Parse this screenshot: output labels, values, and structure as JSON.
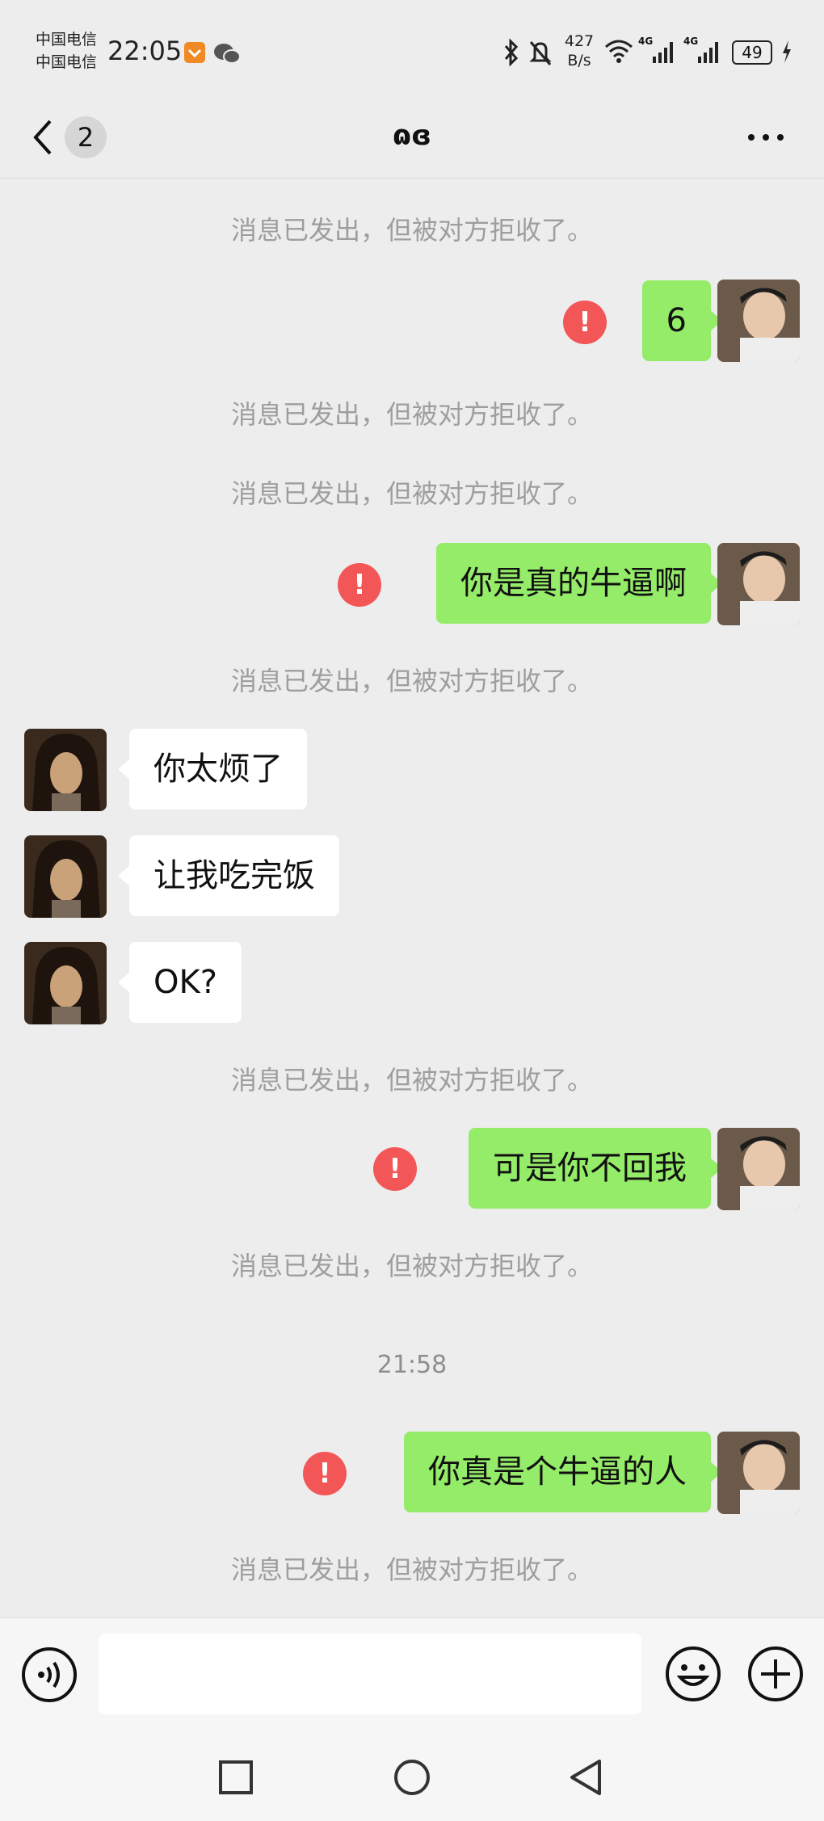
{
  "status_bar": {
    "carrier_1": "中国电信",
    "carrier_2": "中国电信",
    "time": "22:05",
    "net_speed_value": "427",
    "net_speed_unit": "B/s",
    "signal_1": "4G",
    "signal_2": "4G",
    "battery": "49"
  },
  "header": {
    "unread_count": "2",
    "title": "ɷɞ"
  },
  "messages": {
    "m01_sys": "消息已发出，但被对方拒收了。",
    "m02_out": "6",
    "m03_sys": "消息已发出，但被对方拒收了。",
    "m04_sys": "消息已发出，但被对方拒收了。",
    "m05_out": "你是真的牛逼啊",
    "m06_sys": "消息已发出，但被对方拒收了。",
    "m07_in": "你太烦了",
    "m08_in": "让我吃完饭",
    "m09_in": "OK?",
    "m10_sys": "消息已发出，但被对方拒收了。",
    "m11_out": "可是你不回我",
    "m12_sys": "消息已发出，但被对方拒收了。",
    "m13_time": "21:58",
    "m14_out": "你真是个牛逼的人",
    "m15_sys": "消息已发出，但被对方拒收了。",
    "error_mark": "!"
  },
  "input_bar": {
    "voice_icon": "voice-icon",
    "emoji_icon": "emoji-icon",
    "plus_icon": "plus-icon",
    "text_value": ""
  },
  "colors": {
    "outgoing_bubble": "#95ec69",
    "incoming_bubble": "#ffffff",
    "error_badge": "#f25656",
    "background": "#ededed"
  }
}
